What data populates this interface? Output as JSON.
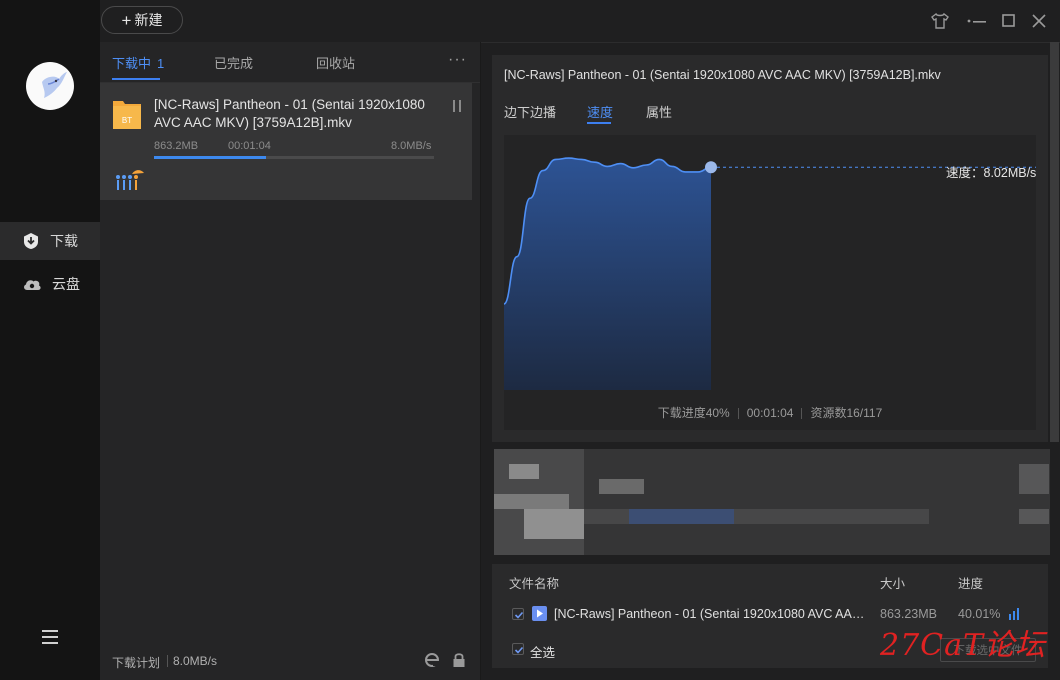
{
  "toolbar": {
    "new_label": "新建"
  },
  "nav": {
    "items": [
      {
        "label": "下载",
        "icon": "download-shield-icon"
      },
      {
        "label": "云盘",
        "icon": "cloud-icon"
      }
    ]
  },
  "list": {
    "tabs": [
      {
        "label": "下载中",
        "count": "1"
      },
      {
        "label": "已完成"
      },
      {
        "label": "回收站"
      }
    ],
    "more_label": "···",
    "item": {
      "name": "[NC-Raws] Pantheon - 01 (Sentai 1920x1080 AVC AAC MKV) [3759A12B].mkv",
      "size": "863.2MB",
      "time": "00:01:04",
      "speed": "8.0MB/s",
      "progress": 0.4,
      "type_badge": "BT"
    },
    "footer": {
      "plan_label": "下载计划",
      "plan_speed": "8.0MB/s"
    }
  },
  "detail": {
    "title": "[NC-Raws] Pantheon - 01 (Sentai 1920x1080 AVC AAC MKV) [3759A12B].mkv",
    "tabs": [
      "边下边播",
      "速度",
      "属性"
    ],
    "speed_label": "速度：8.02MB/s",
    "stats": {
      "progress": "下载进度40%",
      "elapsed": "00:01:04",
      "sources": "资源数16/117"
    }
  },
  "files": {
    "headers": {
      "name": "文件名称",
      "size": "大小",
      "progress": "进度"
    },
    "row": {
      "name": "[NC-Raws] Pantheon - 01 (Sentai 1920x1080 AVC AAC MKV) [3759A12B].mkv",
      "size": "863.23MB",
      "progress": "40.01%"
    },
    "select_all": "全选",
    "download_selected": "下载选中文件"
  },
  "watermark": "27CaT论坛",
  "chart_data": {
    "type": "area",
    "series": [
      {
        "values": [
          3.1,
          4.8,
          6.9,
          7.9,
          8.3,
          8.35,
          8.3,
          8.2,
          8.05,
          8.15,
          8.0,
          8.1,
          8.3,
          8.05,
          7.85,
          7.85,
          8.02
        ]
      }
    ],
    "current": 8.02,
    "ylim": [
      0,
      9
    ]
  },
  "colors": {
    "accent": "#3d7ff0",
    "area_top": "#2d5394",
    "area_bottom": "#1d2a42",
    "line": "#4e8ff5"
  }
}
